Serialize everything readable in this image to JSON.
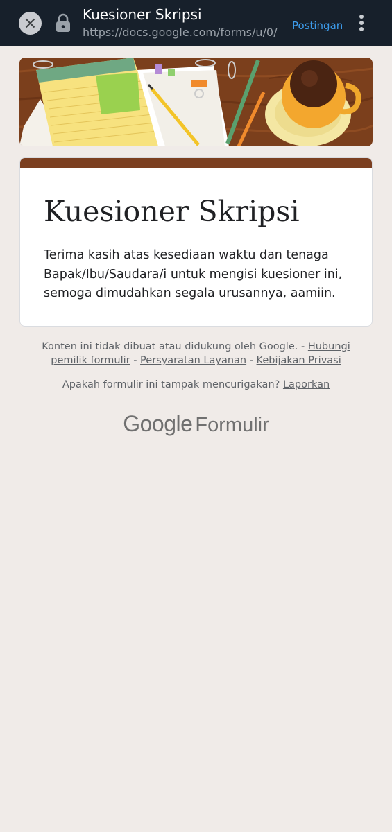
{
  "browser": {
    "title": "Kuesioner Skripsi",
    "url": "https://docs.google.com/forms/u/0/",
    "post_button": "Postingan",
    "close_icon": "close-icon",
    "lock_icon": "lock-icon",
    "menu_icon": "more-vert-icon"
  },
  "form": {
    "title": "Kuesioner Skripsi",
    "description": "Terima kasih atas kesediaan waktu dan tenaga Bapak/Ibu/Saudara/i untuk mengisi kuesioner ini, semoga dimudahkan segala urusannya, aamiin.",
    "accent_color": "#7b3f20"
  },
  "footer": {
    "disclaimer": "Konten ini tidak dibuat atau didukung oleh Google.",
    "separator": " - ",
    "contact_link": "Hubungi pemilik formulir",
    "terms_link": "Persyaratan Layanan",
    "privacy_link": "Kebijakan Privasi",
    "report_question": "Apakah formulir ini tampak mencurigakan?",
    "report_link": "Laporkan",
    "brand_google": "Google",
    "brand_product": "Formulir"
  }
}
